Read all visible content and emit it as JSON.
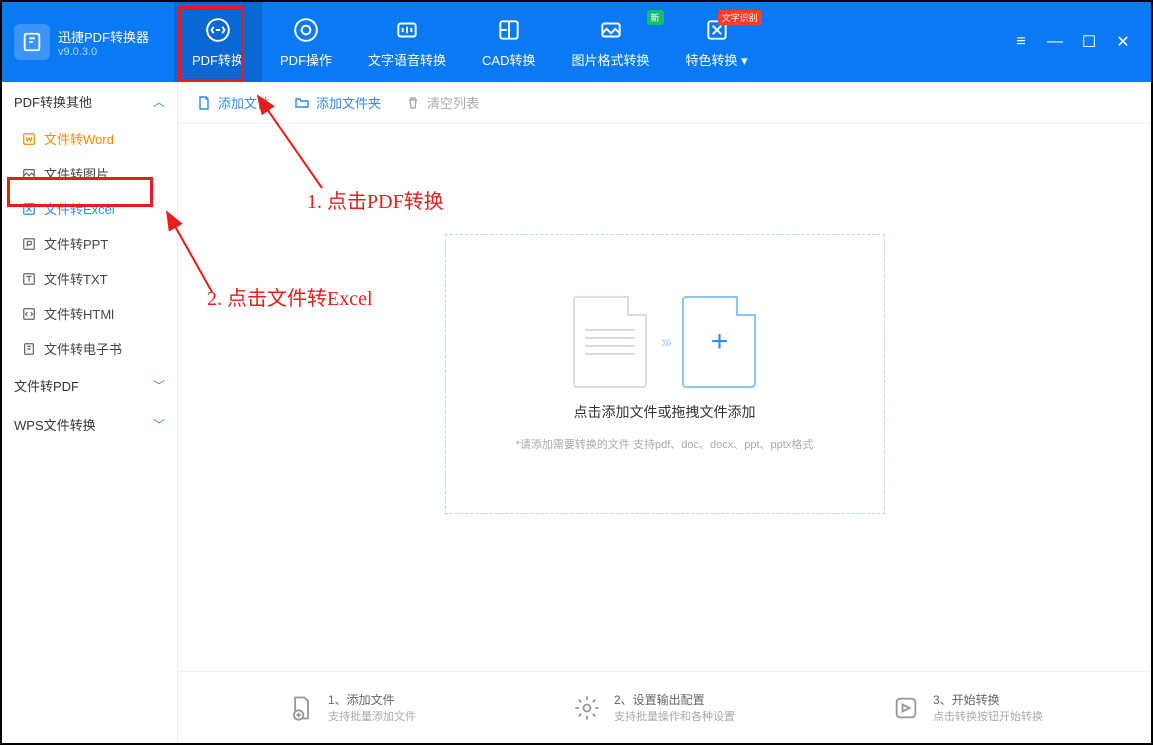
{
  "app": {
    "title": "迅捷PDF转换器",
    "version": "v9.0.3.0"
  },
  "nav": [
    {
      "label": "PDF转换",
      "icon": "swap"
    },
    {
      "label": "PDF操作",
      "icon": "gear"
    },
    {
      "label": "文字语音转换",
      "icon": "audio"
    },
    {
      "label": "CAD转换",
      "icon": "cad"
    },
    {
      "label": "图片格式转换",
      "icon": "image",
      "badge": "新",
      "badgeClass": "green"
    },
    {
      "label": "特色转换",
      "icon": "special",
      "badge": "文字识别",
      "dropdown": true
    }
  ],
  "sidebar": {
    "groups": [
      {
        "label": "PDF转换其他",
        "expanded": true,
        "items": [
          {
            "label": "文件转Word",
            "icon": "w",
            "warm": true
          },
          {
            "label": "文件转图片",
            "icon": "img"
          },
          {
            "label": "文件转Excel",
            "icon": "x",
            "active": true
          },
          {
            "label": "文件转PPT",
            "icon": "p"
          },
          {
            "label": "文件转TXT",
            "icon": "t"
          },
          {
            "label": "文件转HTMl",
            "icon": "h"
          },
          {
            "label": "文件转电子书",
            "icon": "e"
          }
        ]
      },
      {
        "label": "文件转PDF",
        "expanded": false
      },
      {
        "label": "WPS文件转换",
        "expanded": false
      }
    ]
  },
  "toolbar": {
    "add_file": "添加文件",
    "add_folder": "添加文件夹",
    "clear_list": "清空列表"
  },
  "dropzone": {
    "title": "点击添加文件或拖拽文件添加",
    "sub": "*请添加需要转换的文件 支持pdf、doc、docx、ppt、pptx格式"
  },
  "steps": [
    {
      "title": "1、添加文件",
      "sub": "支持批量添加文件"
    },
    {
      "title": "2、设置输出配置",
      "sub": "支持批量操作和各种设置"
    },
    {
      "title": "3、开始转换",
      "sub": "点击转换按钮开始转换"
    }
  ],
  "annotations": {
    "text1": "1. 点击PDF转换",
    "text2": "2. 点击文件转Excel"
  }
}
